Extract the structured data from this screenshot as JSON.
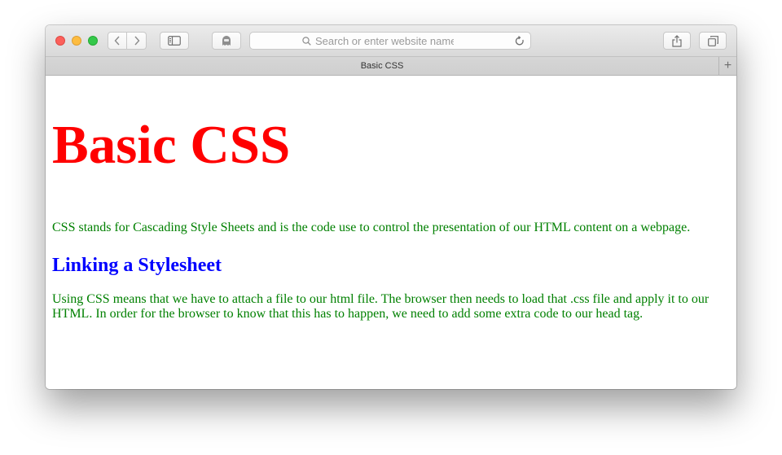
{
  "browser": {
    "address_placeholder": "Search or enter website name",
    "tabs": [
      {
        "label": "Basic CSS",
        "active": true
      }
    ],
    "new_tab_label": "+",
    "icons": {
      "back": "chevron-left-icon",
      "forward": "chevron-right-icon",
      "sidebar": "sidebar-icon",
      "privacy": "ghost-icon",
      "search": "search-icon",
      "reload": "reload-icon",
      "share": "share-icon",
      "tabs": "tabs-icon"
    },
    "colors": {
      "close": "#fc605b",
      "minimize": "#fdbc40",
      "zoom": "#34c84a"
    }
  },
  "page": {
    "heading": "Basic CSS",
    "intro": "CSS stands for Cascading Style Sheets and is the code use to control the presentation of our HTML content on a webpage.",
    "subheading": "Linking a Stylesheet",
    "body": "Using CSS means that we have to attach a file to our html file. The browser then needs to load that .css file and apply it to our HTML. In order for the browser to know that this has to happen, we need to add some extra code to our head tag.",
    "colors": {
      "heading": "#ff0000",
      "subheading": "#0000ff",
      "text": "#008000"
    }
  }
}
